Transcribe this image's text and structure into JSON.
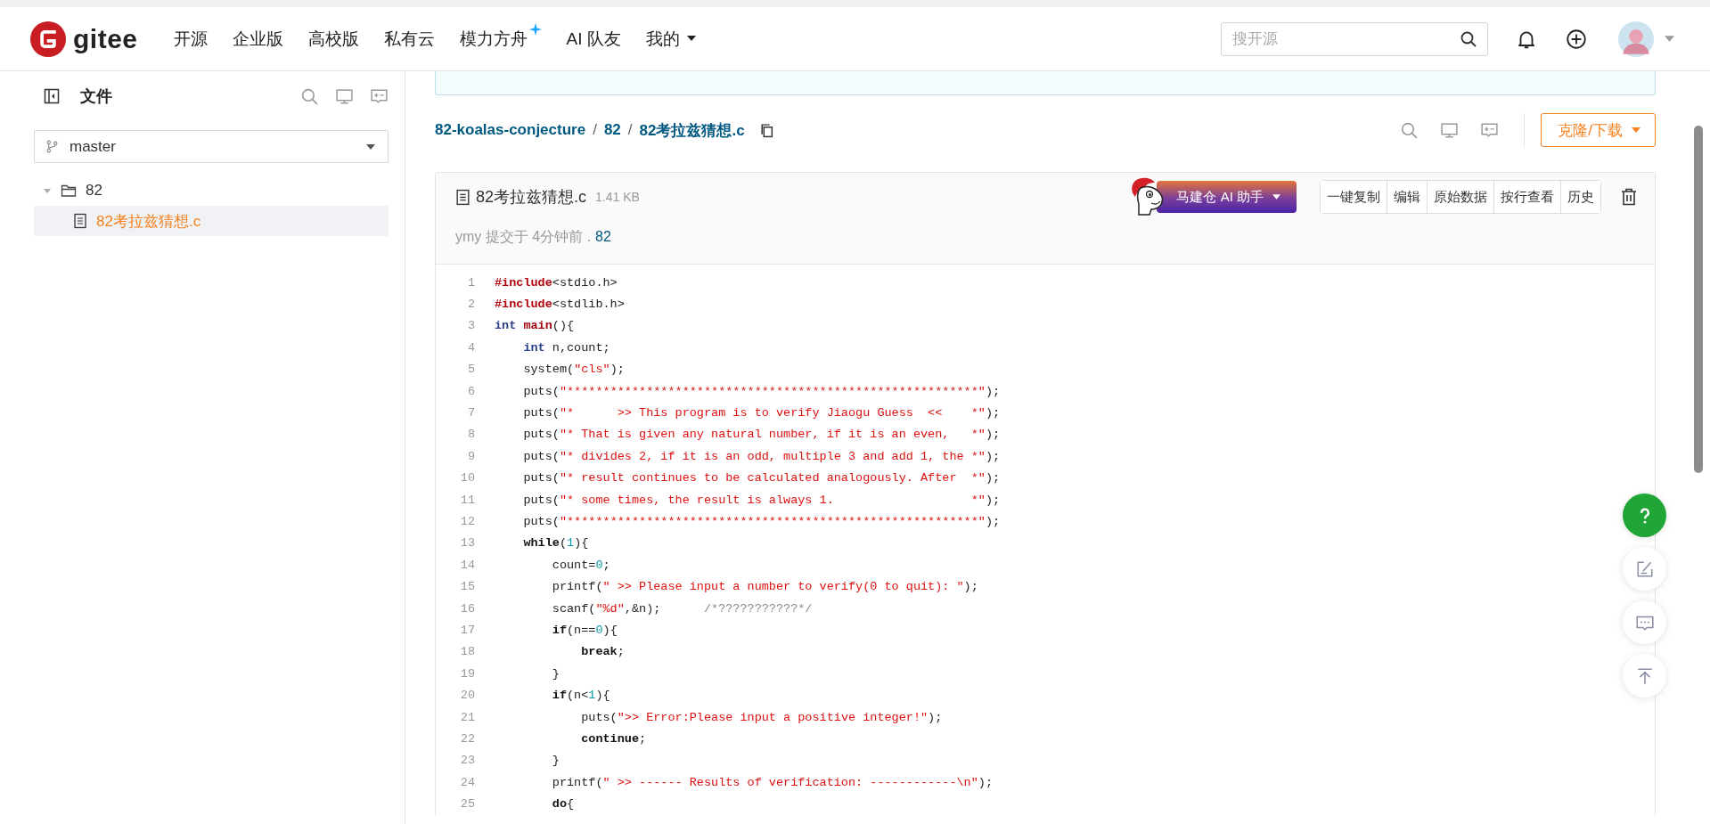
{
  "header": {
    "logo": "gitee",
    "nav": [
      {
        "label": "开源",
        "kind": "link"
      },
      {
        "label": "企业版",
        "kind": "link"
      },
      {
        "label": "高校版",
        "kind": "link"
      },
      {
        "label": "私有云",
        "kind": "link"
      },
      {
        "label": "模力方舟",
        "kind": "sparkle"
      },
      {
        "label": "AI 队友",
        "kind": "link"
      },
      {
        "label": "我的",
        "kind": "dropdown"
      }
    ],
    "search": {
      "placeholder": "搜开源"
    }
  },
  "sidebar": {
    "title": "文件",
    "branch": "master",
    "tree": [
      {
        "name": "82",
        "expanded": true,
        "selected": false,
        "children": [
          {
            "name": "82考拉兹猜想.c",
            "selected": true
          }
        ]
      }
    ]
  },
  "breadcrumb": [
    {
      "label": "82-koalas-conjecture",
      "separator": "/"
    },
    {
      "label": "82",
      "separator": "/"
    },
    {
      "label": "82考拉兹猜想.c"
    }
  ],
  "clone_button": "克隆/下载",
  "file": {
    "name": "82考拉兹猜想.c",
    "size": "1.41 KB",
    "ai_button": "马建仓 AI 助手",
    "actions": [
      "一键复制",
      "编辑",
      "原始数据",
      "按行查看",
      "历史"
    ],
    "commit": {
      "text": "ymy 提交于 4分钟前 .",
      "ref": "82"
    },
    "code": [
      {
        "n": "1",
        "tokens": [
          {
            "kind": "directive",
            "text": "#include"
          },
          {
            "kind": "plain",
            "text": "<stdio.h>"
          }
        ]
      },
      {
        "n": "2",
        "tokens": [
          {
            "kind": "directive",
            "text": "#include"
          },
          {
            "kind": "plain",
            "text": "<stdlib.h>"
          }
        ]
      },
      {
        "n": "3",
        "tokens": [
          {
            "kind": "type",
            "text": "int"
          },
          {
            "kind": "func",
            "text": " main"
          },
          {
            "kind": "plain",
            "text": "(){"
          }
        ]
      },
      {
        "n": "4",
        "tokens": [
          {
            "kind": "type",
            "text": "    int"
          },
          {
            "kind": "plain",
            "text": " n,count;"
          }
        ]
      },
      {
        "n": "5",
        "tokens": [
          {
            "kind": "plain",
            "text": "    system("
          },
          {
            "kind": "string",
            "text": "\"cls\""
          },
          {
            "kind": "plain",
            "text": ");"
          }
        ]
      },
      {
        "n": "6",
        "tokens": [
          {
            "kind": "plain",
            "text": "    puts("
          },
          {
            "kind": "string",
            "text": "\"*********************************************************\""
          },
          {
            "kind": "plain",
            "text": ");"
          }
        ]
      },
      {
        "n": "7",
        "tokens": [
          {
            "kind": "plain",
            "text": "    puts("
          },
          {
            "kind": "string",
            "text": "\"*      >> This program is to verify Jiaogu Guess  <<    *\""
          },
          {
            "kind": "plain",
            "text": ");"
          }
        ]
      },
      {
        "n": "8",
        "tokens": [
          {
            "kind": "plain",
            "text": "    puts("
          },
          {
            "kind": "string",
            "text": "\"* That is given any natural number, if it is an even,   *\""
          },
          {
            "kind": "plain",
            "text": ");"
          }
        ]
      },
      {
        "n": "9",
        "tokens": [
          {
            "kind": "plain",
            "text": "    puts("
          },
          {
            "kind": "string",
            "text": "\"* divides 2, if it is an odd, multiple 3 and add 1, the *\""
          },
          {
            "kind": "plain",
            "text": ");"
          }
        ]
      },
      {
        "n": "10",
        "tokens": [
          {
            "kind": "plain",
            "text": "    puts("
          },
          {
            "kind": "string",
            "text": "\"* result continues to be calculated analogously. After  *\""
          },
          {
            "kind": "plain",
            "text": ");"
          }
        ]
      },
      {
        "n": "11",
        "tokens": [
          {
            "kind": "plain",
            "text": "    puts("
          },
          {
            "kind": "string",
            "text": "\"* some times, the result is always 1.                   *\""
          },
          {
            "kind": "plain",
            "text": ");"
          }
        ]
      },
      {
        "n": "12",
        "tokens": [
          {
            "kind": "plain",
            "text": "    puts("
          },
          {
            "kind": "string",
            "text": "\"*********************************************************\""
          },
          {
            "kind": "plain",
            "text": ");"
          }
        ]
      },
      {
        "n": "13",
        "tokens": [
          {
            "kind": "keyword",
            "text": "    while"
          },
          {
            "kind": "plain",
            "text": "("
          },
          {
            "kind": "number",
            "text": "1"
          },
          {
            "kind": "plain",
            "text": "){"
          }
        ]
      },
      {
        "n": "14",
        "tokens": [
          {
            "kind": "plain",
            "text": "        count="
          },
          {
            "kind": "number",
            "text": "0"
          },
          {
            "kind": "plain",
            "text": ";"
          }
        ]
      },
      {
        "n": "15",
        "tokens": [
          {
            "kind": "plain",
            "text": "        printf("
          },
          {
            "kind": "string",
            "text": "\" >> Please input a number to verify(0 to quit): \""
          },
          {
            "kind": "plain",
            "text": ");"
          }
        ]
      },
      {
        "n": "16",
        "tokens": [
          {
            "kind": "plain",
            "text": "        scanf("
          },
          {
            "kind": "string",
            "text": "\"%d\""
          },
          {
            "kind": "plain",
            "text": ",&n);"
          },
          {
            "kind": "comment",
            "text": "      /*???????????*/"
          }
        ]
      },
      {
        "n": "17",
        "tokens": [
          {
            "kind": "keyword",
            "text": "        if"
          },
          {
            "kind": "plain",
            "text": "(n=="
          },
          {
            "kind": "number",
            "text": "0"
          },
          {
            "kind": "plain",
            "text": "){"
          }
        ]
      },
      {
        "n": "18",
        "tokens": [
          {
            "kind": "keyword",
            "text": "            break"
          },
          {
            "kind": "plain",
            "text": ";"
          }
        ]
      },
      {
        "n": "19",
        "tokens": [
          {
            "kind": "plain",
            "text": "        }"
          }
        ]
      },
      {
        "n": "20",
        "tokens": [
          {
            "kind": "keyword",
            "text": "        if"
          },
          {
            "kind": "plain",
            "text": "(n<"
          },
          {
            "kind": "number",
            "text": "1"
          },
          {
            "kind": "plain",
            "text": "){"
          }
        ]
      },
      {
        "n": "21",
        "tokens": [
          {
            "kind": "plain",
            "text": "            puts("
          },
          {
            "kind": "string",
            "text": "\">> Error:Please input a positive integer!\""
          },
          {
            "kind": "plain",
            "text": ");"
          }
        ]
      },
      {
        "n": "22",
        "tokens": [
          {
            "kind": "keyword",
            "text": "            continue"
          },
          {
            "kind": "plain",
            "text": ";"
          }
        ]
      },
      {
        "n": "23",
        "tokens": [
          {
            "kind": "plain",
            "text": "        }"
          }
        ]
      },
      {
        "n": "24",
        "tokens": [
          {
            "kind": "plain",
            "text": "        printf("
          },
          {
            "kind": "string",
            "text": "\" >> ------ Results of verification: ------------\\n\""
          },
          {
            "kind": "plain",
            "text": ");"
          }
        ]
      },
      {
        "n": "25",
        "tokens": [
          {
            "kind": "keyword",
            "text": "        do"
          },
          {
            "kind": "plain",
            "text": "{"
          }
        ]
      }
    ]
  }
}
